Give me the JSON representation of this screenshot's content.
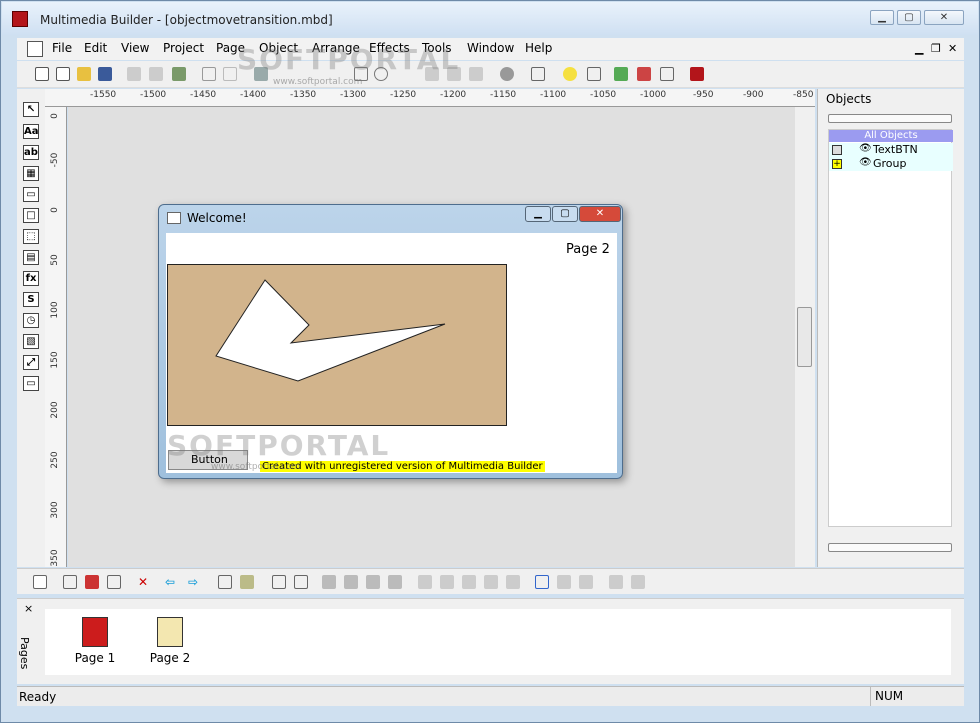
{
  "window": {
    "title": "Multimedia Builder - [objectmovetransition.mbd]",
    "min_symbol": "▁",
    "max_symbol": "▢",
    "close_symbol": "✕"
  },
  "menu": {
    "items": [
      "File",
      "Edit",
      "View",
      "Project",
      "Page",
      "Object",
      "Arrange",
      "Effects",
      "Tools",
      "Window",
      "Help"
    ],
    "mdi_min": "▁",
    "mdi_restore": "❐",
    "mdi_close": "✕"
  },
  "ruler": {
    "h_ticks": [
      "-1550",
      "-1500",
      "-1450",
      "-1400",
      "-1350",
      "-1300",
      "-1250",
      "-1200",
      "-1150",
      "-1100",
      "-1050",
      "-1000",
      "-950",
      "-900",
      "-850"
    ],
    "v_ticks": [
      "0",
      "-50",
      "0",
      "50",
      "100",
      "150",
      "200",
      "250",
      "300",
      "350"
    ]
  },
  "left_tools": [
    "↖",
    "Aa",
    "ab",
    "▦",
    "▭",
    "□",
    "⬚",
    "▤",
    "fx",
    "S",
    "◷",
    "▧",
    "⤢",
    "▭"
  ],
  "preview": {
    "title": "Welcome!",
    "min_symbol": "▁",
    "max_symbol": "▢",
    "close_symbol": "✕",
    "page_label": "Page 2",
    "button_label": "Button",
    "unregistered_text": "Created with unregistered version of Multimedia Builder"
  },
  "objects": {
    "header": "Objects",
    "all_label": "All Objects",
    "rows": [
      {
        "label": "TextBTN"
      },
      {
        "label": "Group"
      }
    ]
  },
  "pages": {
    "label": "Pages",
    "close_symbol": "×",
    "items": [
      {
        "label": "Page 1",
        "icon_color": "#cc1c1c"
      },
      {
        "label": "Page 2",
        "icon_color": "#f3e7b0"
      }
    ]
  },
  "status": {
    "ready": "Ready",
    "num": "NUM"
  },
  "watermark": {
    "text": "SOFTPORTAL",
    "url": "www.softportal.com"
  },
  "colors": {
    "canvas": "#e0e0e0",
    "tan": "#d2b48c",
    "highlight": "#ffff00",
    "all_objects": "#9b9bf0"
  }
}
